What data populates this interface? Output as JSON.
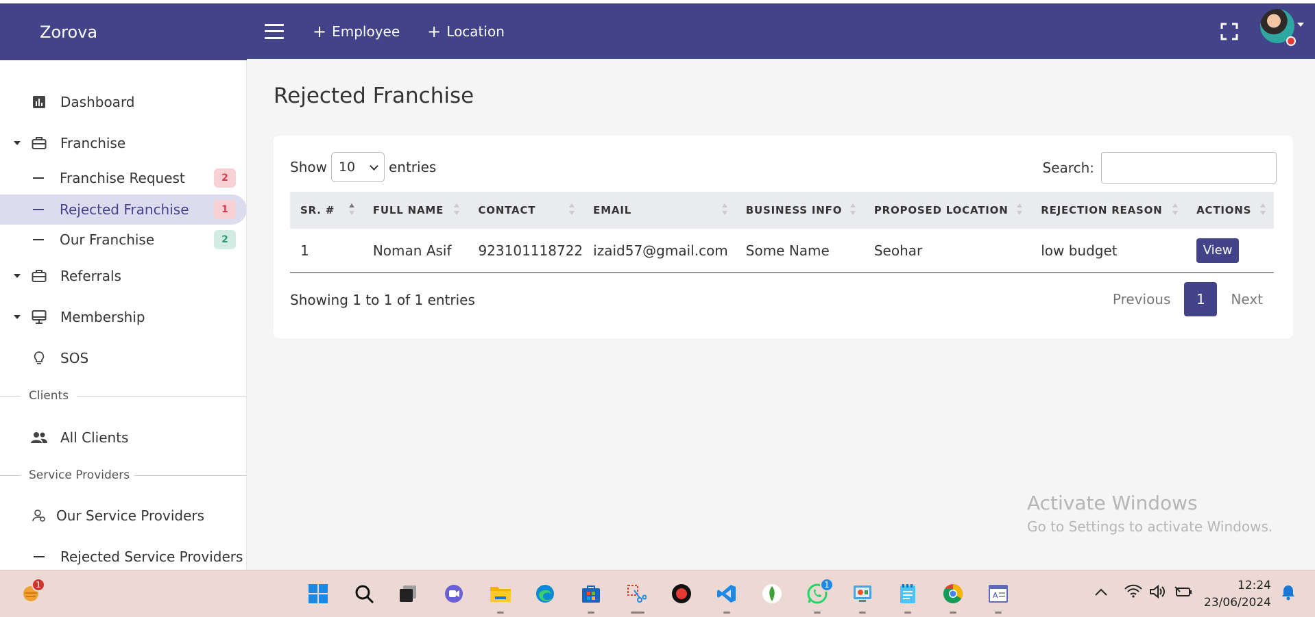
{
  "app": {
    "brand": "Zorova"
  },
  "topbar": {
    "links": [
      {
        "label": "Employee"
      },
      {
        "label": "Location"
      }
    ]
  },
  "sidebar": {
    "items": [
      {
        "label": "Dashboard",
        "icon": "bar-chart-icon"
      },
      {
        "label": "Franchise",
        "icon": "briefcase-icon",
        "expandable": true
      },
      {
        "label": "Referrals",
        "icon": "briefcase-icon",
        "expandable": true
      },
      {
        "label": "Membership",
        "icon": "monitor-icon",
        "expandable": true
      },
      {
        "label": "SOS",
        "icon": "lightbulb-icon"
      }
    ],
    "franchise_sub": [
      {
        "label": "Franchise Request",
        "badge": "2",
        "badge_color": "#d63c4b"
      },
      {
        "label": "Rejected Franchise",
        "badge": "1",
        "badge_color": "#d63c4b",
        "active": true
      },
      {
        "label": "Our Franchise",
        "badge": "2",
        "badge_color": "#2f9a72"
      }
    ],
    "sections": [
      {
        "title": "Clients",
        "items": [
          {
            "label": "All Clients",
            "icon": "people-icon"
          }
        ]
      },
      {
        "title": "Service Providers",
        "items": [
          {
            "label": "Our Service Providers",
            "icon": "user-settings-icon"
          },
          {
            "label": "Rejected Service Providers",
            "icon": "dash-icon"
          }
        ]
      }
    ]
  },
  "main": {
    "title": "Rejected Franchise",
    "table_controls": {
      "show_label": "Show",
      "page_size": "10",
      "entries_label": "entries",
      "search_label": "Search:",
      "search_value": ""
    },
    "table": {
      "columns": [
        "SR. #",
        "FULL NAME",
        "CONTACT",
        "EMAIL",
        "BUSINESS INFO",
        "PROPOSED LOCATION",
        "REJECTION REASON",
        "ACTIONS"
      ],
      "rows": [
        {
          "sr": "1",
          "full_name": "Noman Asif",
          "contact": "923101118722",
          "email": "izaid57@gmail.com",
          "business_info": "Some Name",
          "proposed_location": "Seohar",
          "rejection_reason": "low budget",
          "action_label": "View"
        }
      ]
    },
    "footer": {
      "info": "Showing 1 to 1 of 1 entries",
      "previous": "Previous",
      "current_page": "1",
      "next": "Next"
    }
  },
  "watermark": {
    "line1": "Activate Windows",
    "line2": "Go to Settings to activate Windows."
  },
  "taskbar": {
    "weather_badge": "1",
    "whatsapp_badge": "1",
    "time": "12:24",
    "date": "23/06/2024"
  },
  "colors": {
    "primary": "#434389",
    "badge_red": "#d63c4b",
    "badge_green": "#2f9a72",
    "taskbar": "#ecd9d3"
  }
}
